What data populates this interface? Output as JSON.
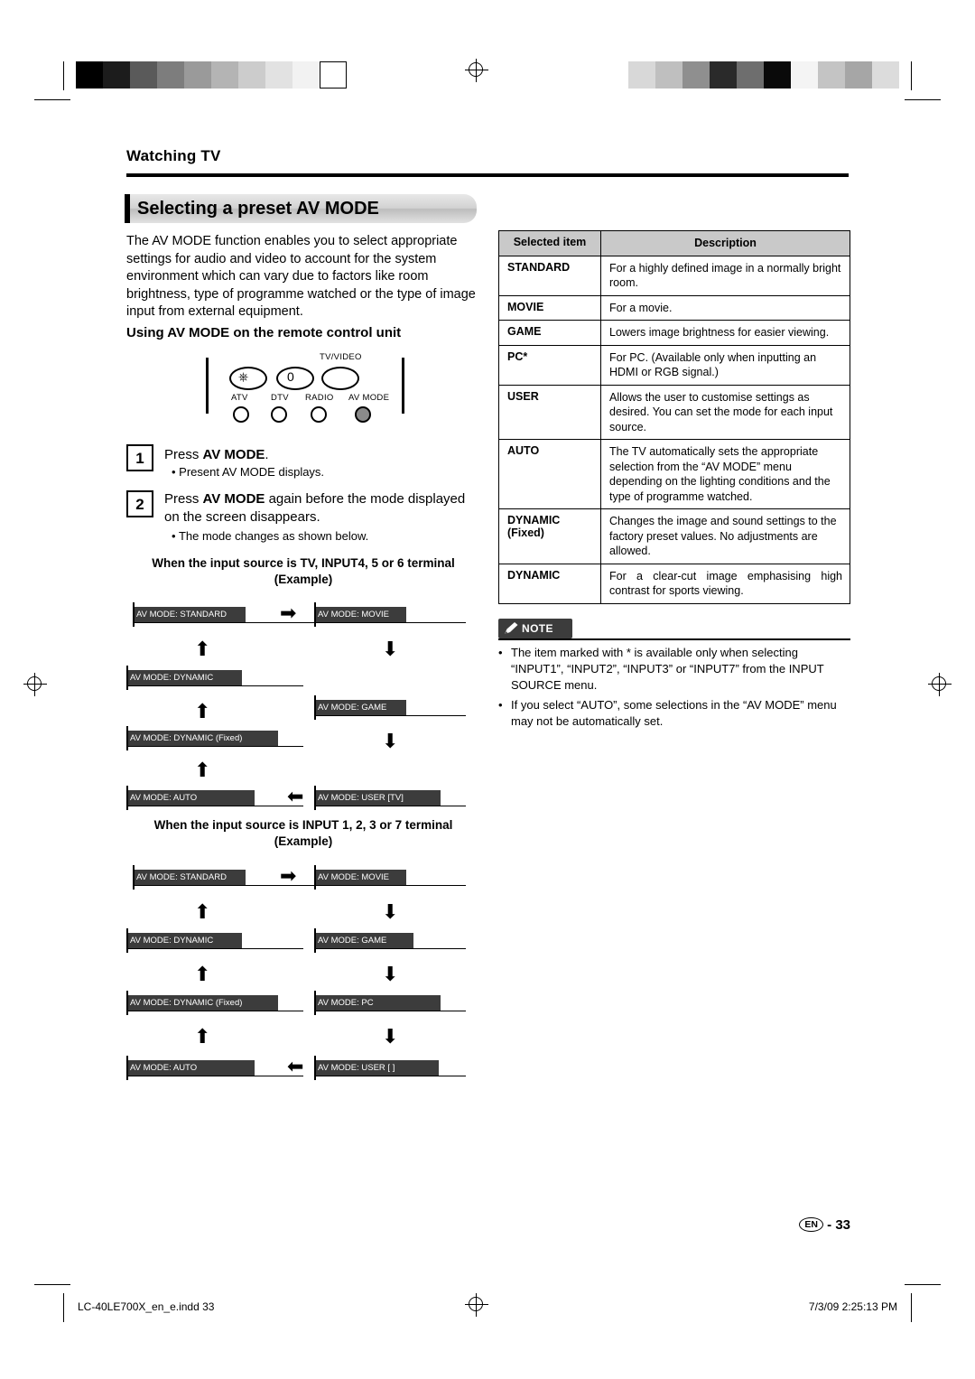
{
  "header": {
    "section": "Watching TV",
    "title": "Selecting a preset AV MODE"
  },
  "intro": "The AV MODE function enables you to select appropriate settings for audio and video to account for the system environment which can vary due to factors like room brightness, type of programme watched or the type of image input from external equipment.",
  "subhead": "Using AV MODE on the remote control unit",
  "remote": {
    "label_tvvideo": "TV/VIDEO",
    "label_atv": "ATV",
    "label_dtv": "DTV",
    "label_radio": "RADIO",
    "label_avmode": "AV MODE"
  },
  "steps": [
    {
      "num": "1",
      "text": "Press AV MODE.",
      "text_plain": "Press ",
      "text_bold": "AV MODE",
      "text_tail": ".",
      "bullet": "Present AV MODE displays."
    },
    {
      "num": "2",
      "text_plain": "Press ",
      "text_bold": "AV MODE",
      "text_tail": " again before the mode displayed on the screen disappears.",
      "bullet": "The mode changes as shown below."
    }
  ],
  "flow1": {
    "heading_line1": "When the input source is TV, INPUT4, 5 or 6 terminal",
    "heading_line2": "(Example)",
    "boxes": {
      "standard": "AV MODE: STANDARD",
      "movie": "AV MODE: MOVIE",
      "dynamic": "AV MODE: DYNAMIC",
      "game": "AV MODE: GAME",
      "dynamic_fixed": "AV MODE: DYNAMIC (Fixed)",
      "auto": "AV MODE: AUTO",
      "user": "AV MODE: USER [TV]"
    }
  },
  "flow2": {
    "heading_line1": "When the input source is INPUT 1, 2, 3 or 7 terminal",
    "heading_line2": "(Example)",
    "boxes": {
      "standard": "AV MODE: STANDARD",
      "movie": "AV MODE: MOVIE",
      "dynamic": "AV MODE: DYNAMIC",
      "game": "AV MODE: GAME",
      "dynamic_fixed": "AV MODE: DYNAMIC (Fixed)",
      "pc": "AV MODE: PC",
      "auto": "AV MODE: AUTO",
      "user": "AV MODE: USER [    ]"
    }
  },
  "table": {
    "headers": [
      "Selected item",
      "Description"
    ],
    "rows": [
      {
        "item": "STANDARD",
        "item2": "",
        "desc": "For a highly defined image in a normally bright room."
      },
      {
        "item": "MOVIE",
        "item2": "",
        "desc": "For a movie."
      },
      {
        "item": "GAME",
        "item2": "",
        "desc": "Lowers image brightness for easier viewing."
      },
      {
        "item": "PC*",
        "item2": "",
        "desc": "For PC. (Available only when inputting an HDMI or RGB signal.)"
      },
      {
        "item": "USER",
        "item2": "",
        "desc": "Allows the user to customise settings as desired. You can set the mode for each input source."
      },
      {
        "item": "AUTO",
        "item2": "",
        "desc": "The TV automatically sets the appropriate selection from the “AV MODE” menu depending on the lighting conditions and the type of programme watched."
      },
      {
        "item": "DYNAMIC",
        "item2": "(Fixed)",
        "desc": "Changes the image and sound settings to the factory preset values. No adjustments are allowed."
      },
      {
        "item": "DYNAMIC",
        "item2": "",
        "desc": "For a clear-cut image emphasising high contrast for sports viewing."
      }
    ]
  },
  "note": {
    "label": "NOTE",
    "items": [
      "The item marked with * is available only when selecting “INPUT1”, “INPUT2”, “INPUT3” or “INPUT7” from the INPUT SOURCE menu.",
      "If you select “AUTO”, some selections in the “AV MODE” menu may not be automatically set."
    ]
  },
  "footer": {
    "page_prefix": "EN",
    "page_sep": "-",
    "page_number": "33",
    "file": "LC-40LE700X_en_e.indd   33",
    "timestamp": "7/3/09   2:25:13 PM"
  }
}
